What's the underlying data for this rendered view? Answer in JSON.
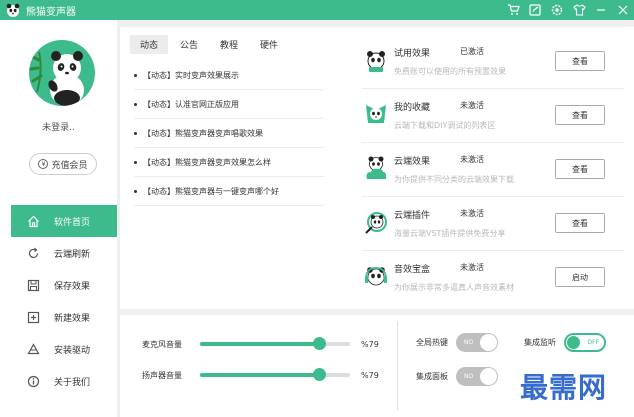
{
  "app": {
    "title": "熊猫变声器"
  },
  "sidebar": {
    "login_text": "未登录..",
    "vip_button": "充值会员",
    "items": [
      {
        "label": "软件首页",
        "icon": "home-icon",
        "active": true
      },
      {
        "label": "云端刷新",
        "icon": "refresh-icon",
        "active": false
      },
      {
        "label": "保存效果",
        "icon": "save-icon",
        "active": false
      },
      {
        "label": "新建效果",
        "icon": "add-icon",
        "active": false
      },
      {
        "label": "安装驱动",
        "icon": "drive-icon",
        "active": false
      },
      {
        "label": "关于我们",
        "icon": "info-icon",
        "active": false
      }
    ]
  },
  "tabs": [
    "动态",
    "公告",
    "教程",
    "硬件"
  ],
  "news": [
    "【动态】实时变声效果展示",
    "【动态】认准官网正版应用",
    "【动态】熊猫变声器变声唱歌效果",
    "【动态】熊猫变声器变声效果怎么样",
    "【动态】熊猫变声器与一键变声哪个好"
  ],
  "features": [
    {
      "name": "试用效果",
      "status": "已激活",
      "desc": "免费账可以使用的所有预置效果",
      "button": "查看",
      "icon": "panda-trial-icon"
    },
    {
      "name": "我的收藏",
      "status": "未激活",
      "desc": "云端下载和DIY调试的列表区",
      "button": "查看",
      "icon": "panda-favorite-icon"
    },
    {
      "name": "云端效果",
      "status": "未激活",
      "desc": "为你提供不同分类的云端效果下载",
      "button": "查看",
      "icon": "panda-cloud-icon"
    },
    {
      "name": "云端插件",
      "status": "未激活",
      "desc": "海量云端VST插件提供免费分享",
      "button": "查看",
      "icon": "panda-plugin-icon"
    },
    {
      "name": "音效宝盒",
      "status": "未激活",
      "desc": "为你展示非常多逼真人声音效素材",
      "button": "启动",
      "icon": "panda-soundbox-icon"
    }
  ],
  "volume": {
    "mic_label": "麦克风音量",
    "mic_value": "%79",
    "mic_level": 0.79,
    "speaker_label": "扬声器音量",
    "speaker_value": "%79",
    "speaker_level": 0.79
  },
  "toggles": {
    "hotkey_label": "全局热键",
    "hotkey_state": "NO",
    "monitor_label": "集成监听",
    "monitor_state": "OFF",
    "panel_label": "集成面板",
    "panel_state": "NO"
  },
  "watermark": "最需网",
  "colors": {
    "accent": "#3dbb8d",
    "watermark": "#2560c8"
  }
}
